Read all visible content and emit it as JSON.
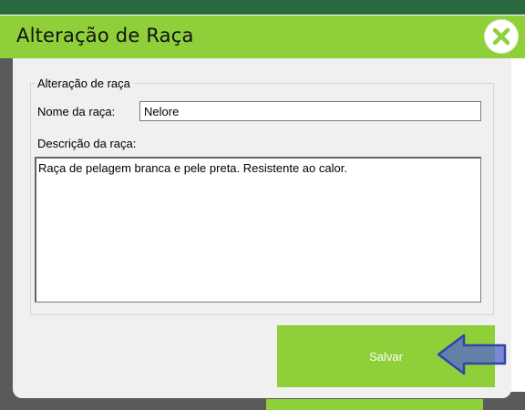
{
  "window": {
    "title": "Alteração de Raça",
    "close_icon": "close-icon"
  },
  "form": {
    "group_label": "Alteração de raça",
    "name_label": "Nome da raça:",
    "name_value": "Nelore",
    "description_label": "Descrição da raça:",
    "description_value": "Raça de pelagem branca e pele preta. Resistente ao calor."
  },
  "actions": {
    "save_label": "Salvar"
  },
  "annotation": {
    "icon": "left-arrow-indicator",
    "color": "#5566cc"
  },
  "colors": {
    "accent": "#8ecf3a",
    "panel": "#f0f0f0"
  }
}
